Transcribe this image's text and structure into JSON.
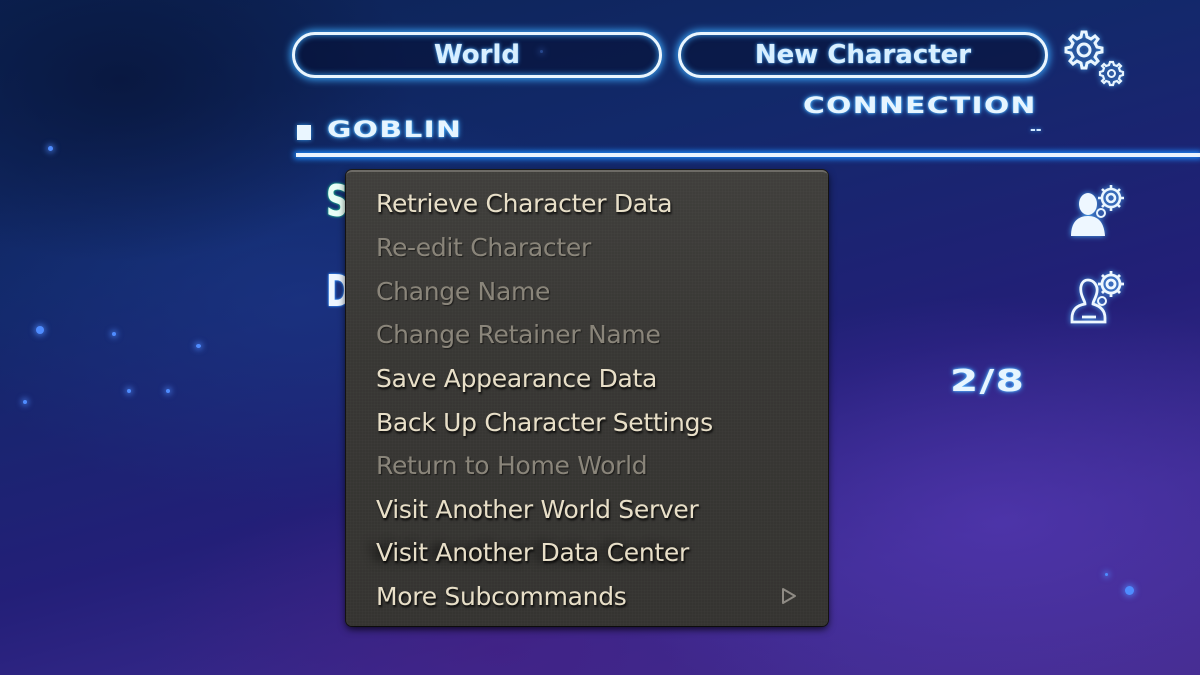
{
  "header": {
    "world_button": "World",
    "new_character_button": "New Character",
    "settings_icon": "gears-icon"
  },
  "server": {
    "connection_label": "CONNECTION",
    "connection_value": "--",
    "world_name": "GOBLIN"
  },
  "characters": [
    {
      "name_visible": "S",
      "status_icon": "character-settings-filled-icon"
    },
    {
      "name_visible": "D",
      "status_icon": "character-settings-outline-icon"
    }
  ],
  "character_count": "2/8",
  "context_menu": {
    "items": [
      {
        "label": "Retrieve Character Data",
        "enabled": true
      },
      {
        "label": "Re-edit Character",
        "enabled": false
      },
      {
        "label": "Change Name",
        "enabled": false
      },
      {
        "label": "Change Retainer Name",
        "enabled": false
      },
      {
        "label": "Save Appearance Data",
        "enabled": true
      },
      {
        "label": "Back Up Character Settings",
        "enabled": true
      },
      {
        "label": "Return to Home World",
        "enabled": false
      },
      {
        "label": "Visit Another World Server",
        "enabled": true
      },
      {
        "label": "Visit Another Data Center",
        "enabled": true,
        "hovered": true
      },
      {
        "label": "More Subcommands",
        "enabled": true,
        "submenu": true
      }
    ]
  },
  "colors": {
    "glow_blue": "#3caaff",
    "menu_bg": "#393836",
    "menu_text_enabled": "#e8dfc8",
    "menu_text_disabled": "#8a857a",
    "char1_accent": "#1fb38a",
    "char2_accent": "#2f8bff"
  }
}
